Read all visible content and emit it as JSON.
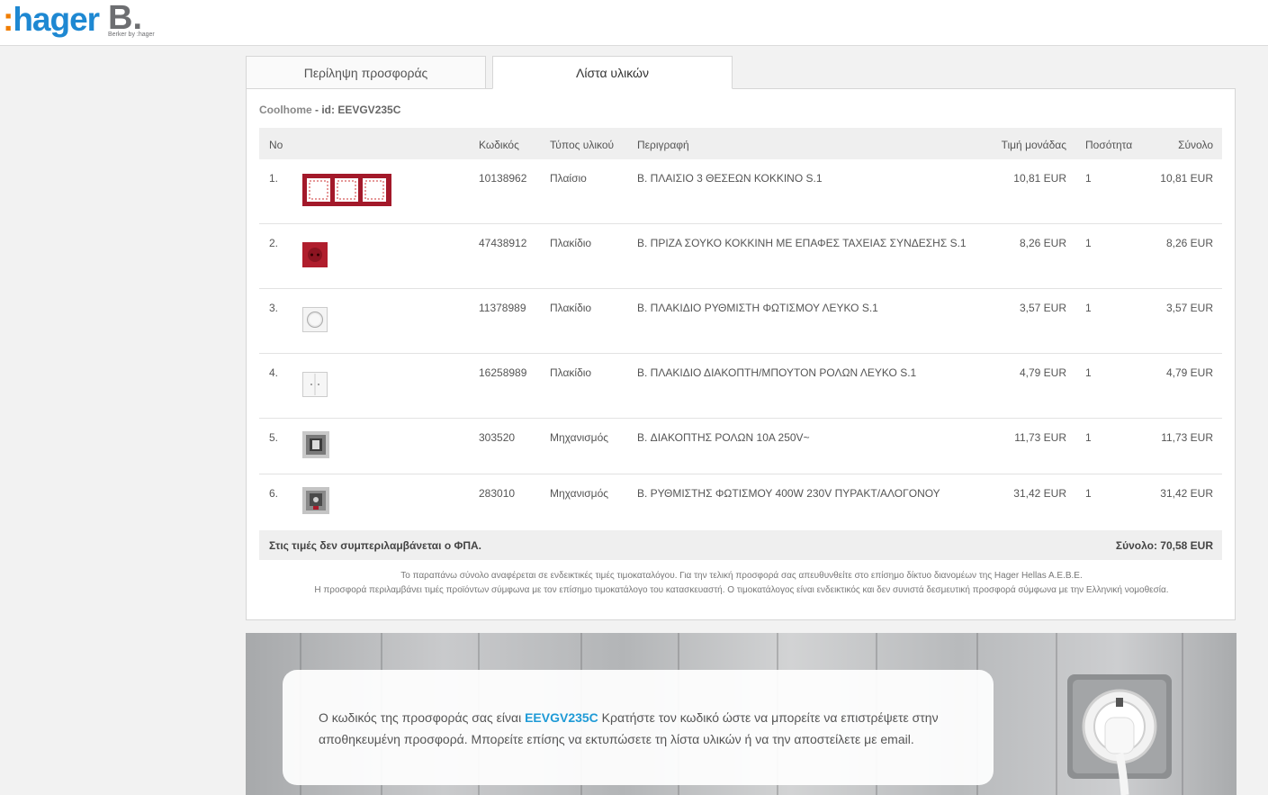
{
  "header": {
    "logo_hager_colon": ":",
    "logo_hager_text": "hager",
    "logo_b": "B.",
    "logo_b_sub": "Berker by :hager"
  },
  "tabs": [
    {
      "label": "Περίληψη προσφοράς",
      "active": false
    },
    {
      "label": "Λίστα υλικών",
      "active": true
    }
  ],
  "project": {
    "name": "Coolhome",
    "id_label": "- id: EEVGV235C"
  },
  "table": {
    "headers": {
      "no": "No",
      "code": "Κωδικός",
      "type": "Τύπος υλικού",
      "desc": "Περιγραφή",
      "price": "Τιμή μονάδας",
      "qty": "Ποσότητα",
      "total": "Σύνολο"
    },
    "rows": [
      {
        "no": "1.",
        "code": "10138962",
        "type": "Πλαίσιο",
        "desc": "B. ΠΛΑΙΣΙΟ 3 ΘΕΣΕΩΝ ΚΟΚΚΙΝΟ S.1",
        "price": "10,81 EUR",
        "qty": "1",
        "total": "10,81 EUR",
        "thumb": "red-triple-frame"
      },
      {
        "no": "2.",
        "code": "47438912",
        "type": "Πλακίδιο",
        "desc": "B. ΠΡΙΖΑ ΣΟΥΚΟ ΚΟΚΚΙΝΗ ΜΕ ΕΠΑΦΕΣ ΤΑΧΕΙΑΣ ΣΥΝΔΕΣΗΣ S.1",
        "price": "8,26 EUR",
        "qty": "1",
        "total": "8,26 EUR",
        "thumb": "red-socket"
      },
      {
        "no": "3.",
        "code": "11378989",
        "type": "Πλακίδιο",
        "desc": "B. ΠΛΑΚΙΔΙΟ ΡΥΘΜΙΣΤΗ ΦΩΤΙΣΜΟΥ ΛΕΥΚΟ S.1",
        "price": "3,57 EUR",
        "qty": "1",
        "total": "3,57 EUR",
        "thumb": "white-dimmer"
      },
      {
        "no": "4.",
        "code": "16258989",
        "type": "Πλακίδιο",
        "desc": "B. ΠΛΑΚΙΔΙΟ ΔΙΑΚΟΠΤΗ/ΜΠΟΥΤΟΝ ΡΟΛΩΝ ΛΕΥΚΟ S.1",
        "price": "4,79 EUR",
        "qty": "1",
        "total": "4,79 EUR",
        "thumb": "white-blind-switch"
      },
      {
        "no": "5.",
        "code": "303520",
        "type": "Μηχανισμός",
        "desc": "B. ΔΙΑΚΟΠΤΗΣ ΡΟΛΩΝ 10A 250V~",
        "price": "11,73 EUR",
        "qty": "1",
        "total": "11,73 EUR",
        "thumb": "switch-mechanism"
      },
      {
        "no": "6.",
        "code": "283010",
        "type": "Μηχανισμός",
        "desc": "B. ΡΥΘΜΙΣΤΗΣ ΦΩΤΙΣΜΟΥ 400W 230V ΠΥΡΑΚΤ/ΑΛΟΓΟΝΟΥ",
        "price": "31,42 EUR",
        "qty": "1",
        "total": "31,42 EUR",
        "thumb": "dimmer-mechanism"
      }
    ],
    "vat_note": "Στις τιμές δεν συμπεριλαμβάνεται ο ΦΠΑ.",
    "sum": "Σύνολο: 70,58 EUR"
  },
  "notes": {
    "line1": "Το παραπάνω σύνολο αναφέρεται σε ενδεικτικές τιμές τιμοκαταλόγου. Για την τελική προσφορά σας απευθυνθείτε στο επίσημο δίκτυο διανομέων της Hager Hellas A.E.B.E.",
    "line2": "Η προσφορά περιλαμβάνει τιμές προϊόντων σύμφωνα με τον επίσημο τιμοκατάλογο του κατασκευαστή. Ο τιμοκατάλογος είναι ενδεικτικός και δεν συνιστά δεσμευτική προσφορά σύμφωνα με την Ελληνική νομοθεσία."
  },
  "banner": {
    "text_before": "Ο κωδικός της προσφοράς σας είναι ",
    "code": "EEVGV235C",
    "text_after": " Κρατήστε τον κωδικό ώστε να μπορείτε να επιστρέψετε στην αποθηκευμένη προσφορά. Μπορείτε επίσης να εκτυπώσετε τη λίστα υλικών ή να την αποστείλετε με email."
  },
  "colors": {
    "brand_blue": "#1e88d2",
    "brand_orange": "#f07d00",
    "code_highlight": "#1e9ad6",
    "product_red": "#b01e2d"
  }
}
